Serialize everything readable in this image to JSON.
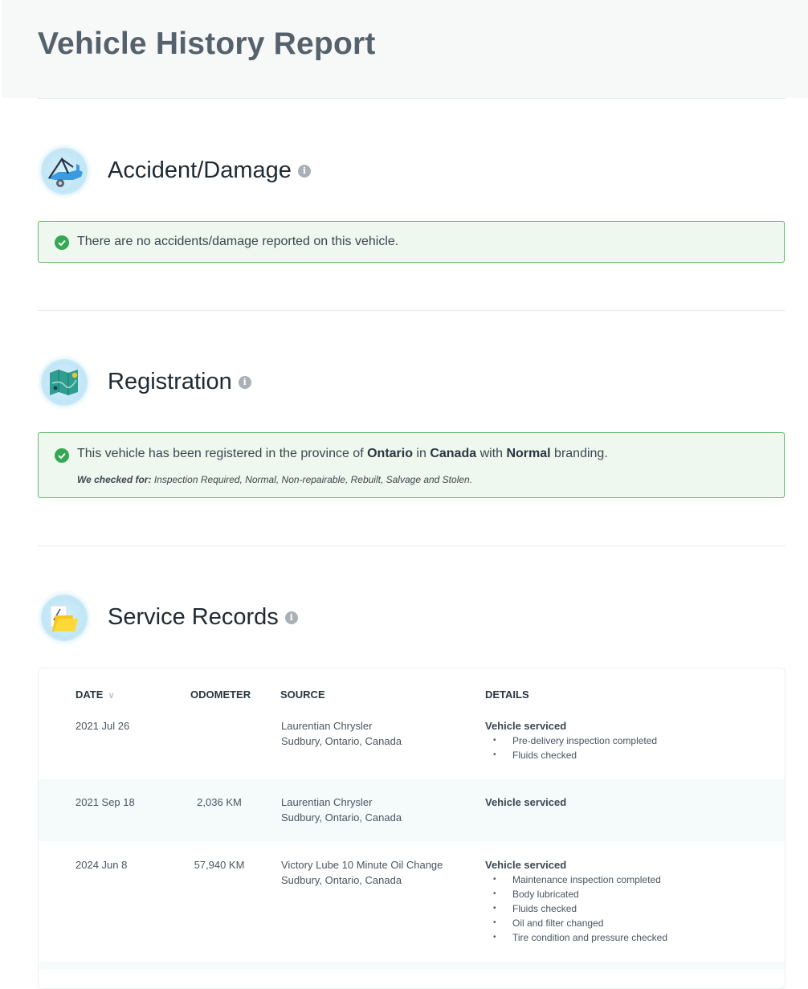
{
  "page": {
    "title": "Vehicle History Report"
  },
  "accident": {
    "title": "Accident/Damage",
    "message": "There are no accidents/damage reported on this vehicle."
  },
  "registration": {
    "title": "Registration",
    "message_prefix": "This vehicle has been registered in the province of ",
    "province": "Ontario",
    "message_mid": " in ",
    "country": "Canada",
    "message_mid2": " with ",
    "branding": "Normal",
    "message_suffix": " branding.",
    "checked_label": "We checked for:",
    "checked_items": " Inspection Required, Normal, Non-repairable, Rebuilt, Salvage and Stolen."
  },
  "service": {
    "title": "Service Records",
    "columns": {
      "date": "DATE",
      "odometer": "ODOMETER",
      "source": "SOURCE",
      "details": "DETAILS"
    },
    "records": [
      {
        "date": "2021 Jul 26",
        "odometer": "",
        "source_name": "Laurentian Chrysler",
        "source_location": "Sudbury, Ontario, Canada",
        "detail_title": "Vehicle serviced",
        "items": [
          "Pre-delivery inspection completed",
          "Fluids checked"
        ]
      },
      {
        "date": "2021 Sep 18",
        "odometer": "2,036 KM",
        "source_name": "Laurentian Chrysler",
        "source_location": "Sudbury, Ontario, Canada",
        "detail_title": "Vehicle serviced",
        "items": []
      },
      {
        "date": "2024 Jun 8",
        "odometer": "57,940 KM",
        "source_name": "Victory Lube 10 Minute Oil Change",
        "source_location": "Sudbury, Ontario, Canada",
        "detail_title": "Vehicle serviced",
        "items": [
          "Maintenance inspection completed",
          "Body lubricated",
          "Fluids checked",
          "Oil and filter changed",
          "Tire condition and pressure checked"
        ]
      }
    ]
  },
  "colors": {
    "success_border": "#5ebd62",
    "success_bg": "#eef8ee",
    "check": "#34a853",
    "header_bg": "#f7f8f8"
  },
  "icons": {
    "accident": "tow-truck-icon",
    "registration": "map-icon",
    "service": "folder-icon",
    "info": "info-icon",
    "check": "check-circle-icon",
    "sort": "chevron-down-icon"
  }
}
